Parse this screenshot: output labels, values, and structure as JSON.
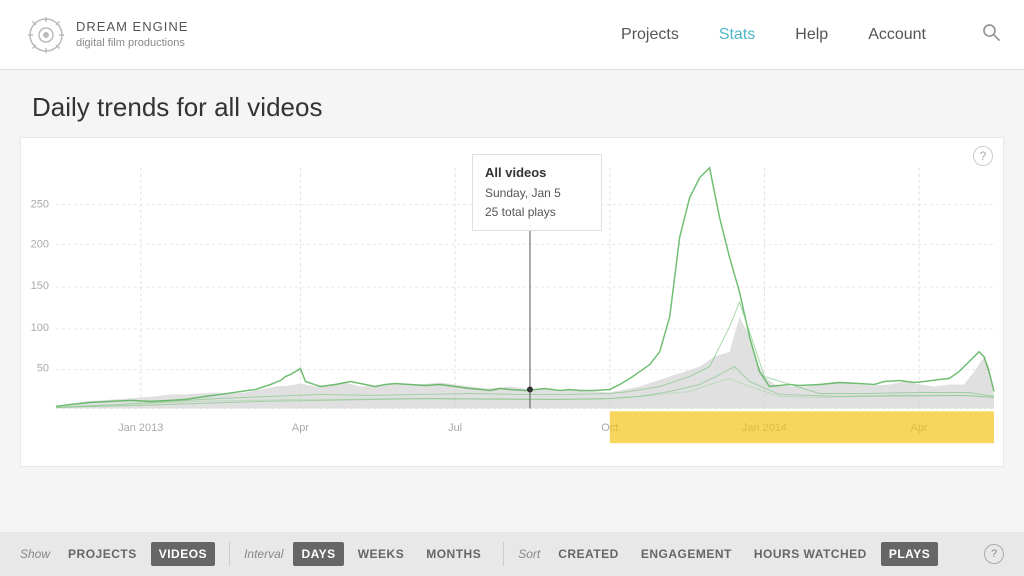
{
  "header": {
    "logo_brand": "DREAM ENGINE",
    "logo_sub": "digital film productions",
    "nav": {
      "projects": "Projects",
      "stats": "Stats",
      "help": "Help",
      "account": "Account"
    }
  },
  "page": {
    "title": "Daily trends for all videos"
  },
  "tooltip": {
    "title": "All videos",
    "date": "Sunday, Jan 5",
    "plays": "25 total plays"
  },
  "chart": {
    "y_labels": [
      "250",
      "200",
      "150",
      "100",
      "50"
    ],
    "x_labels": [
      "Jan 2013",
      "Apr",
      "Jul",
      "Oct",
      "Jan 2014",
      "Apr"
    ]
  },
  "bottom_bar": {
    "show_label": "Show",
    "show_projects": "PROJECTS",
    "show_videos": "VIDEOS",
    "interval_label": "Interval",
    "interval_days": "DAYS",
    "interval_weeks": "WEEKS",
    "interval_months": "MONTHS",
    "sort_label": "Sort",
    "sort_created": "CREATED",
    "sort_engagement": "ENGAGEMENT",
    "sort_hours_watched": "HOURS WATCHED",
    "sort_plays": "PLAYS",
    "help": "?"
  }
}
